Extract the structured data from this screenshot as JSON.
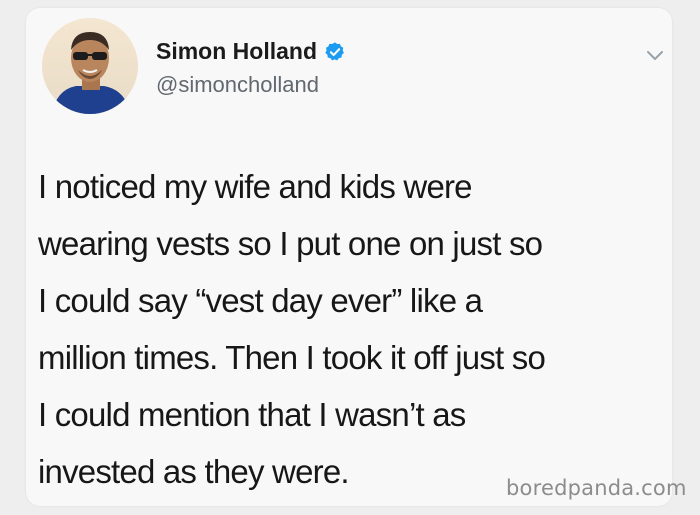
{
  "user": {
    "display_name": "Simon Holland",
    "handle": "@simoncholland",
    "verified": true
  },
  "tweet": {
    "lines": [
      "I noticed my wife and kids were",
      "wearing vests so I put one on just so",
      "I could say “vest day ever” like a",
      "million times. Then I took it off just so",
      "I could mention that I wasn’t as",
      "invested as they were."
    ]
  },
  "watermark": "boredpanda.com",
  "icons": {
    "verified": "verified-badge-icon",
    "more": "chevron-down-icon"
  },
  "colors": {
    "verified_blue": "#1d9bf0",
    "handle_gray": "#606870",
    "card_bg": "#f8f8f8"
  }
}
